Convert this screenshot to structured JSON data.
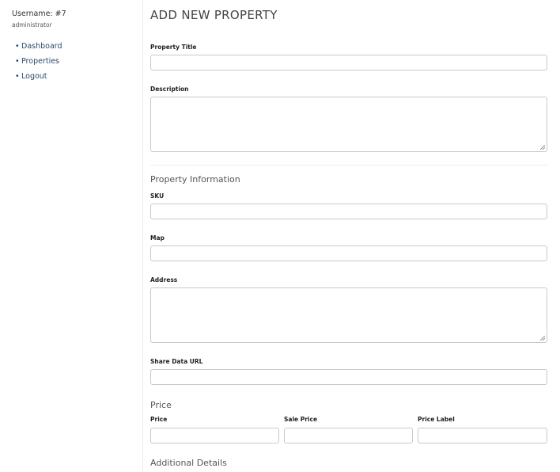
{
  "sidebar": {
    "username": "Username: #7",
    "role": "administrator",
    "nav": [
      "Dashboard",
      "Properties",
      "Logout"
    ]
  },
  "page": {
    "title": "ADD NEW PROPERTY"
  },
  "form": {
    "property_title_label": "Property Title",
    "description_label": "Description",
    "property_info_heading": "Property Information",
    "sku_label": "SKU",
    "map_label": "Map",
    "address_label": "Address",
    "share_data_url_label": "Share Data URL",
    "price_heading": "Price",
    "price_label": "Price",
    "sale_price_label": "Sale Price",
    "price_label_label": "Price Label",
    "additional_details_heading": "Additional Details"
  }
}
